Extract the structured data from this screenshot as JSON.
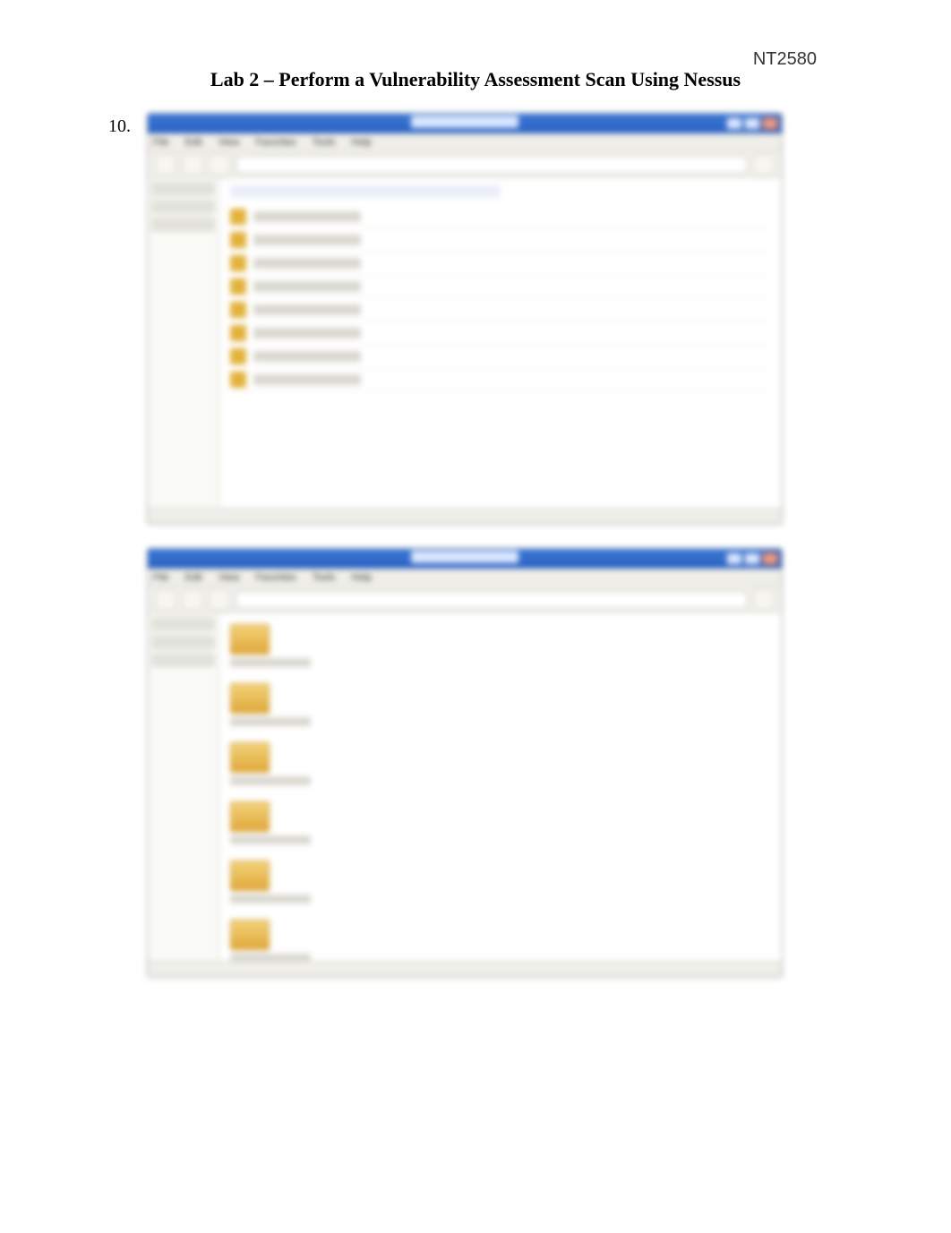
{
  "header": {
    "course_code": "NT2580",
    "lab_title": "Lab 2 – Perform a Vulnerability Assessment Scan Using Nessus"
  },
  "step": {
    "number": "10."
  },
  "figures": {
    "top_window": {
      "description": "File explorer window showing a list of scan result items (blurred screenshot)",
      "titlebar_label": "",
      "menu_items": [
        "File",
        "Edit",
        "View",
        "Favorites",
        "Tools",
        "Help"
      ],
      "address_bar": "",
      "list_rows": [
        "",
        "",
        "",
        "",
        "",
        "",
        "",
        ""
      ]
    },
    "bottom_window": {
      "description": "File explorer window showing folder icons in the content pane (blurred screenshot)",
      "titlebar_label": "",
      "menu_items": [
        "File",
        "Edit",
        "View",
        "Favorites",
        "Tools",
        "Help"
      ],
      "address_bar": "",
      "icon_items": [
        "",
        "",
        "",
        "",
        "",
        ""
      ]
    }
  },
  "colors": {
    "titlebar_blue": "#2a60c0",
    "folder_yellow": "#e0a83a",
    "page_bg": "#ffffff",
    "window_bg": "#f2f1ec"
  }
}
